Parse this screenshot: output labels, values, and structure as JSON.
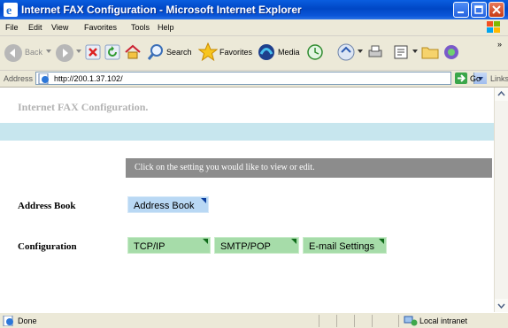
{
  "window": {
    "title": "Internet FAX Configuration - Microsoft Internet Explorer"
  },
  "menu": {
    "items": [
      "File",
      "Edit",
      "View",
      "Favorites",
      "Tools",
      "Help"
    ]
  },
  "toolbar": {
    "back": "Back",
    "search": "Search",
    "favorites": "Favorites",
    "media": "Media"
  },
  "address": {
    "label": "Address",
    "url": "http://200.1.37.102/",
    "go": "Go",
    "links": "Links"
  },
  "page": {
    "heading": "Internet FAX Configuration.",
    "instruction": "Click on the setting you would like to view or edit.",
    "address_book_label": "Address Book",
    "address_book_button": "Address Book",
    "configuration_label": "Configuration",
    "config_buttons": [
      "TCP/IP",
      "SMTP/POP",
      "E-mail Settings"
    ]
  },
  "status": {
    "text": "Done",
    "zone": "Local intranet"
  },
  "colors": {
    "band": "#c7e6ee",
    "instruction_bg": "#8c8c8c",
    "blue_button": "#b9d8f4",
    "green_button": "#a6dca9"
  }
}
